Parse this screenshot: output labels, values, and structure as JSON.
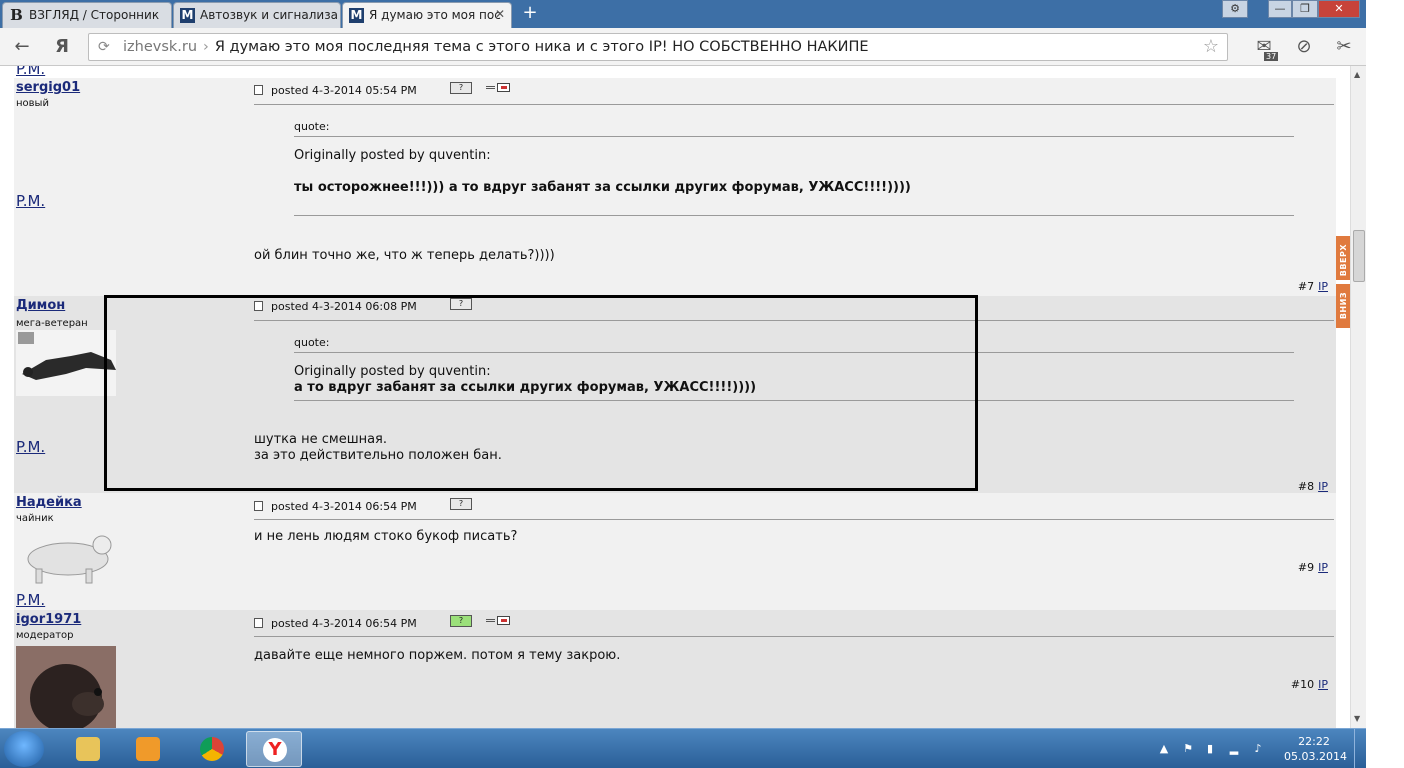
{
  "browser": {
    "tabs": [
      {
        "label": "ВЗГЛЯД / Сторонник",
        "favicon": "B"
      },
      {
        "label": "Автозвук и сигнализа",
        "favicon": "M"
      },
      {
        "label": "Я думаю это моя пос",
        "favicon": "M",
        "active": true
      }
    ],
    "new_tab": "+",
    "window_buttons": {
      "settings": "⚙",
      "minimize": "—",
      "restore": "❐",
      "close": "✕"
    },
    "nav": {
      "back": "←",
      "yandex": "Я"
    },
    "address": {
      "host": "izhevsk.ru",
      "separator": "›",
      "title": "Я думаю это моя последняя тема с этого ника и с этого IP! НО СОБСТВЕННО НАКИПЕ"
    },
    "extensions": {
      "mail_count": "37"
    }
  },
  "forum": {
    "top_pm": "P.M.",
    "posts": [
      {
        "author": "sergig01",
        "rank": "новый",
        "posted": "posted 4-3-2014 05:54 PM",
        "quote_label": "quote:",
        "quote_from": "Originally posted by quventin:",
        "quote_text": "ты осторожнее!!!))) а то вдруг забанят за ссылки других форумав, УЖАСС!!!!))))",
        "body": [
          "ой блин точно же, что ж теперь делать?))))"
        ],
        "pm": "P.M.",
        "num": "#7",
        "ip": "IP"
      },
      {
        "author": "Димон",
        "rank": "мега-ветеран",
        "posted": "posted 4-3-2014 06:08 PM",
        "quote_label": "quote:",
        "quote_from": "Originally posted by quventin:",
        "quote_text": "а то вдруг забанят за ссылки других форумав, УЖАСС!!!!))))",
        "body": [
          "шутка не смешная.",
          "за это действительно положен бан."
        ],
        "pm": "P.M.",
        "num": "#8",
        "ip": "IP"
      },
      {
        "author": "Надейка",
        "rank": "чайник",
        "posted": "posted 4-3-2014 06:54 PM",
        "body": [
          "и не лень людям стоко букоф писать?"
        ],
        "pm": "P.M.",
        "num": "#9",
        "ip": "IP"
      },
      {
        "author": "igor1971",
        "rank": "модератор",
        "posted": "posted 4-3-2014 06:54 PM",
        "body": [
          "давайте еще немного поржем. потом я тему закрою."
        ],
        "num": "#10",
        "ip": "IP"
      }
    ],
    "scroll_widget": {
      "up": "ВВЕРХ",
      "down": "ВНИЗ"
    }
  },
  "taskbar": {
    "clock_time": "22:22",
    "clock_date": "05.03.2014",
    "apps": [
      "explorer-icon",
      "media-player-icon",
      "chrome-icon",
      "yandex-browser-icon"
    ]
  }
}
